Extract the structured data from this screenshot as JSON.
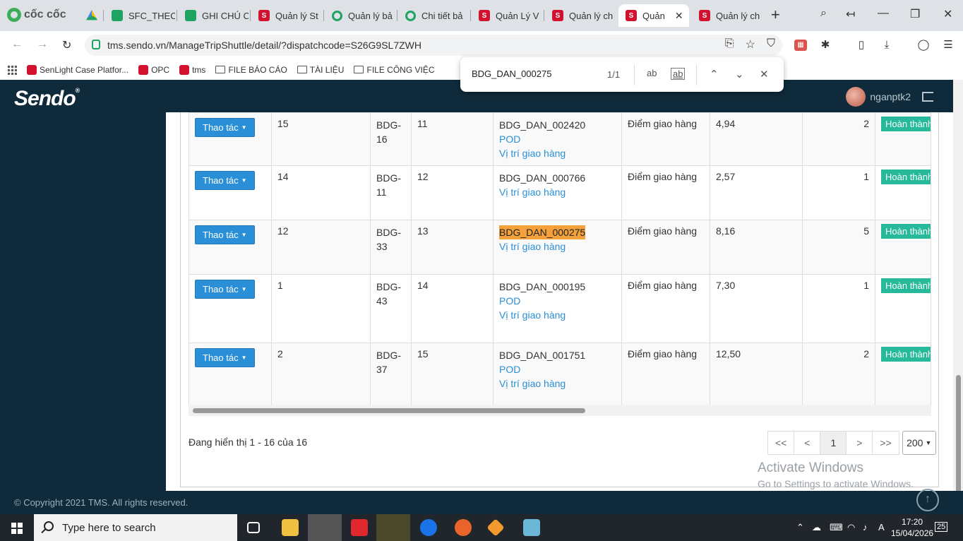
{
  "browser": {
    "brand": "cốc cốc",
    "tabs": [
      {
        "label": "",
        "favicon": "google-drive"
      },
      {
        "label": "SFC_THEO",
        "favicon": "sheets"
      },
      {
        "label": "GHI CHÚ C",
        "favicon": "sheets"
      },
      {
        "label": "Quản lý St",
        "favicon": "sendo"
      },
      {
        "label": "Quản lý bả",
        "favicon": "green-ring"
      },
      {
        "label": "Chi tiết bả",
        "favicon": "green-ring"
      },
      {
        "label": "Quản Lý V",
        "favicon": "sendo"
      },
      {
        "label": "Quản lý ch",
        "favicon": "sendo"
      },
      {
        "label": "Quản",
        "favicon": "sendo",
        "active": true
      },
      {
        "label": "Quản lý ch",
        "favicon": "sendo"
      }
    ],
    "url": "tms.sendo.vn/ManageTripShuttle/detail/?dispatchcode=S26G9SL7ZWH",
    "bookmarks": [
      {
        "label": "SenLight Case Platfor...",
        "type": "sendo"
      },
      {
        "label": "OPC",
        "type": "sendo"
      },
      {
        "label": "tms",
        "type": "sendo"
      },
      {
        "label": "FILE BÁO CÁO",
        "type": "folder"
      },
      {
        "label": "TÀI LIỆU",
        "type": "folder"
      },
      {
        "label": "FILE CÔNG VIỆC",
        "type": "folder"
      }
    ],
    "find": {
      "query": "BDG_DAN_000275",
      "count": "1/1",
      "opt_case": "ab",
      "opt_word": "ab"
    }
  },
  "app": {
    "logo": "Sendo",
    "logo_mark": "®",
    "username": "nganptk2",
    "action_label": "Thao tác",
    "rows": [
      {
        "col1": "15",
        "col2": "BDG-\n16",
        "seq": "11",
        "code": "BDG_DAN_002420",
        "pod": "POD",
        "loc": "Vị trí giao hàng",
        "type": "Điểm giao hàng",
        "dist": "4,94",
        "qty": "2",
        "status": "Hoàn thành"
      },
      {
        "col1": "14",
        "col2": "BDG-\n11",
        "seq": "12",
        "code": "BDG_DAN_000766",
        "pod": "",
        "loc": "Vị trí giao hàng",
        "type": "Điểm giao hàng",
        "dist": "2,57",
        "qty": "1",
        "status": "Hoàn thành"
      },
      {
        "col1": "12",
        "col2": "BDG-\n33",
        "seq": "13",
        "code": "BDG_DAN_000275",
        "pod": "",
        "loc": "Vị trí giao hàng",
        "type": "Điểm giao hàng",
        "dist": "8,16",
        "qty": "5",
        "status": "Hoàn thành",
        "highlight": true
      },
      {
        "col1": "1",
        "col2": "BDG-\n43",
        "seq": "14",
        "code": "BDG_DAN_000195",
        "pod": "POD",
        "loc": "Vị trí giao hàng",
        "type": "Điểm giao hàng",
        "dist": "7,30",
        "qty": "1",
        "status": "Hoàn thành"
      },
      {
        "col1": "2",
        "col2": "BDG-\n37",
        "seq": "15",
        "code": "BDG_DAN_001751",
        "pod": "POD",
        "loc": "Vị trí giao hàng",
        "type": "Điểm giao hàng",
        "dist": "12,50",
        "qty": "2",
        "status": "Hoàn thành"
      }
    ],
    "summary": "Đang hiển thị 1 - 16 của 16",
    "pager": {
      "first": "<<",
      "prev": "<",
      "current": "1",
      "next": ">",
      "last": ">>",
      "page_size": "200"
    },
    "footer": "© Copyright 2021 TMS. All rights reserved.",
    "watermark_title": "Activate Windows",
    "watermark_sub": "Go to Settings to activate Windows."
  },
  "taskbar": {
    "search_placeholder": "Type here to search",
    "time": "17:20",
    "date": "15/04/2026",
    "notifications": "25"
  },
  "colors": {
    "header_bg": "#0f2a3a",
    "action_blue": "#2a8fd6",
    "status_green": "#26b99a",
    "find_highlight": "#f4a13b"
  }
}
